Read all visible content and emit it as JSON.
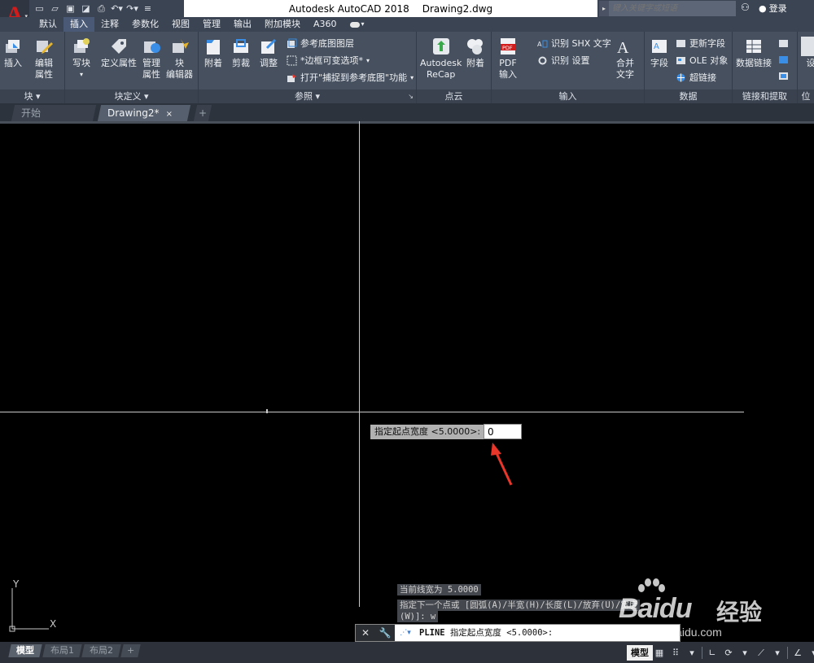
{
  "app": {
    "logo": "A",
    "title": "Autodesk AutoCAD 2018",
    "file": "Drawing2.dwg",
    "search_placeholder": "键入关键字或短语",
    "user": "登录"
  },
  "quick_access": [
    "new-icon",
    "open-icon",
    "save-icon",
    "saveas-icon",
    "print-icon",
    "undo-icon",
    "redo-icon",
    "qat-menu-icon"
  ],
  "menu_tabs": [
    "默认",
    "插入",
    "注释",
    "参数化",
    "视图",
    "管理",
    "输出",
    "附加模块",
    "A360"
  ],
  "active_menu_tab": "插入",
  "ribbon": {
    "block": {
      "title": "块 ▾",
      "insert": "插入",
      "edit_attr": "编辑\n属性"
    },
    "block_def": {
      "title": "块定义 ▾",
      "write_block": "写块",
      "define_attr": "定义属性",
      "manage_attr": "管理\n属性",
      "block_editor": "块\n编辑器"
    },
    "reference": {
      "title": "参照 ▾",
      "attach": "附着",
      "clip": "剪裁",
      "adjust": "调整",
      "underlay_layers": "参考底图图层",
      "frames": "*边框可变选项*",
      "snap": "打开\"捕捉到参考底图\"功能"
    },
    "point_cloud": {
      "title": "点云",
      "recap": "Autodesk\nReCap",
      "attach": "附着"
    },
    "import": {
      "title": "输入",
      "pdf_import": "PDF\n输入",
      "recognize_shx": "识别 SHX 文字",
      "recognize_settings": "识别 设置",
      "combine_text": "合并\n文字"
    },
    "data": {
      "title": "数据",
      "field": "字段",
      "update_fields": "更新字段",
      "ole_object": "OLE 对象",
      "hyperlink": "超链接"
    },
    "linking": {
      "title": "链接和提取",
      "data_link": "数据链接"
    },
    "more": {
      "title": "位",
      "set": "设"
    }
  },
  "file_tabs": [
    "开始",
    "Drawing2*"
  ],
  "active_file_tab": "Drawing2*",
  "dynamic_input": {
    "label": "指定起点宽度 <5.0000>:",
    "value": "0"
  },
  "command_history": [
    "当前线宽为 5.0000",
    "指定下一个点或 [圆弧(A)/半宽(H)/长度(L)/放弃(U)/宽度",
    "(W)]: w"
  ],
  "command_line": {
    "command": "PLINE",
    "prompt": "指定起点宽度 <5.0000>:"
  },
  "watermark": {
    "brand": "Bai",
    "brand2": "du",
    "jy": "经验",
    "url": "jingyan.baidu.com"
  },
  "layout_tabs": [
    "模型",
    "布局1",
    "布局2"
  ],
  "status": {
    "model": "模型"
  },
  "ucs": {
    "x": "X",
    "y": "Y"
  },
  "colors": {
    "accent": "#d21c1c",
    "arrow": "#e8362a",
    "canvas": "#000000",
    "ribbon": "#46505f"
  }
}
